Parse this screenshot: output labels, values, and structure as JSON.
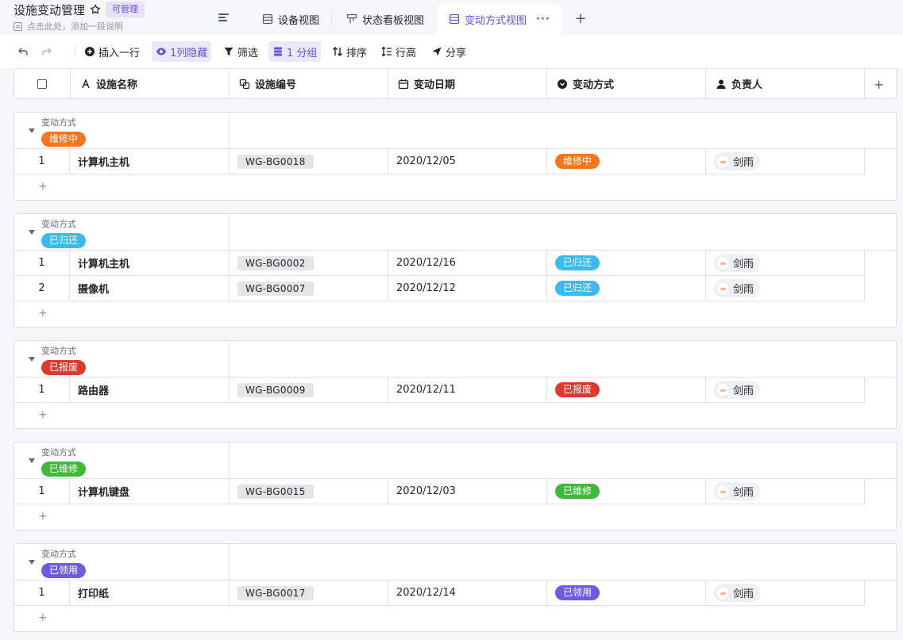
{
  "app": {
    "title": "设施变动管理",
    "permission_badge": "可管理",
    "description_placeholder": "点击此处，添加一段说明"
  },
  "views": [
    {
      "label": "设备视图",
      "icon": "grid-view-icon",
      "active": false
    },
    {
      "label": "状态看板视图",
      "icon": "kanban-icon",
      "active": false
    },
    {
      "label": "变动方式视图",
      "icon": "grid-view-icon",
      "active": true
    }
  ],
  "view_more": "···",
  "add_view": "+",
  "toolbar": {
    "insert_row": "插入一行",
    "hidden_cols": "1列隐藏",
    "filter": "筛选",
    "group": "1 分组",
    "sort": "排序",
    "row_height": "行高",
    "share": "分享"
  },
  "columns": [
    {
      "label": "设施名称",
      "icon": "text-field-icon"
    },
    {
      "label": "设施编号",
      "icon": "link-field-icon"
    },
    {
      "label": "变动日期",
      "icon": "calendar-icon"
    },
    {
      "label": "变动方式",
      "icon": "single-select-icon"
    },
    {
      "label": "负责人",
      "icon": "person-icon"
    }
  ],
  "add_column": "+",
  "group_field_label": "变动方式",
  "groups": [
    {
      "tag": "维修中",
      "color": "#f5761f",
      "rows": [
        {
          "idx": "1",
          "name": "计算机主机",
          "code": "WG-BG0018",
          "date": "2020/12/05",
          "type": "维修中",
          "owner": "剑雨"
        }
      ]
    },
    {
      "tag": "已归还",
      "color": "#3bbbec",
      "rows": [
        {
          "idx": "1",
          "name": "计算机主机",
          "code": "WG-BG0002",
          "date": "2020/12/16",
          "type": "已归还",
          "owner": "剑雨"
        },
        {
          "idx": "2",
          "name": "摄像机",
          "code": "WG-BG0007",
          "date": "2020/12/12",
          "type": "已归还",
          "owner": "剑雨"
        }
      ]
    },
    {
      "tag": "已报废",
      "color": "#dc3a2f",
      "rows": [
        {
          "idx": "1",
          "name": "路由器",
          "code": "WG-BG0009",
          "date": "2020/12/11",
          "type": "已报废",
          "owner": "剑雨"
        }
      ]
    },
    {
      "tag": "已维修",
      "color": "#3fb93a",
      "rows": [
        {
          "idx": "1",
          "name": "计算机键盘",
          "code": "WG-BG0015",
          "date": "2020/12/03",
          "type": "已维修",
          "owner": "剑雨"
        }
      ]
    },
    {
      "tag": "已领用",
      "color": "#6c5ce0",
      "rows": [
        {
          "idx": "1",
          "name": "打印纸",
          "code": "WG-BG0017",
          "date": "2020/12/14",
          "type": "已领用",
          "owner": "剑雨"
        }
      ]
    }
  ],
  "add_row_symbol": "+"
}
